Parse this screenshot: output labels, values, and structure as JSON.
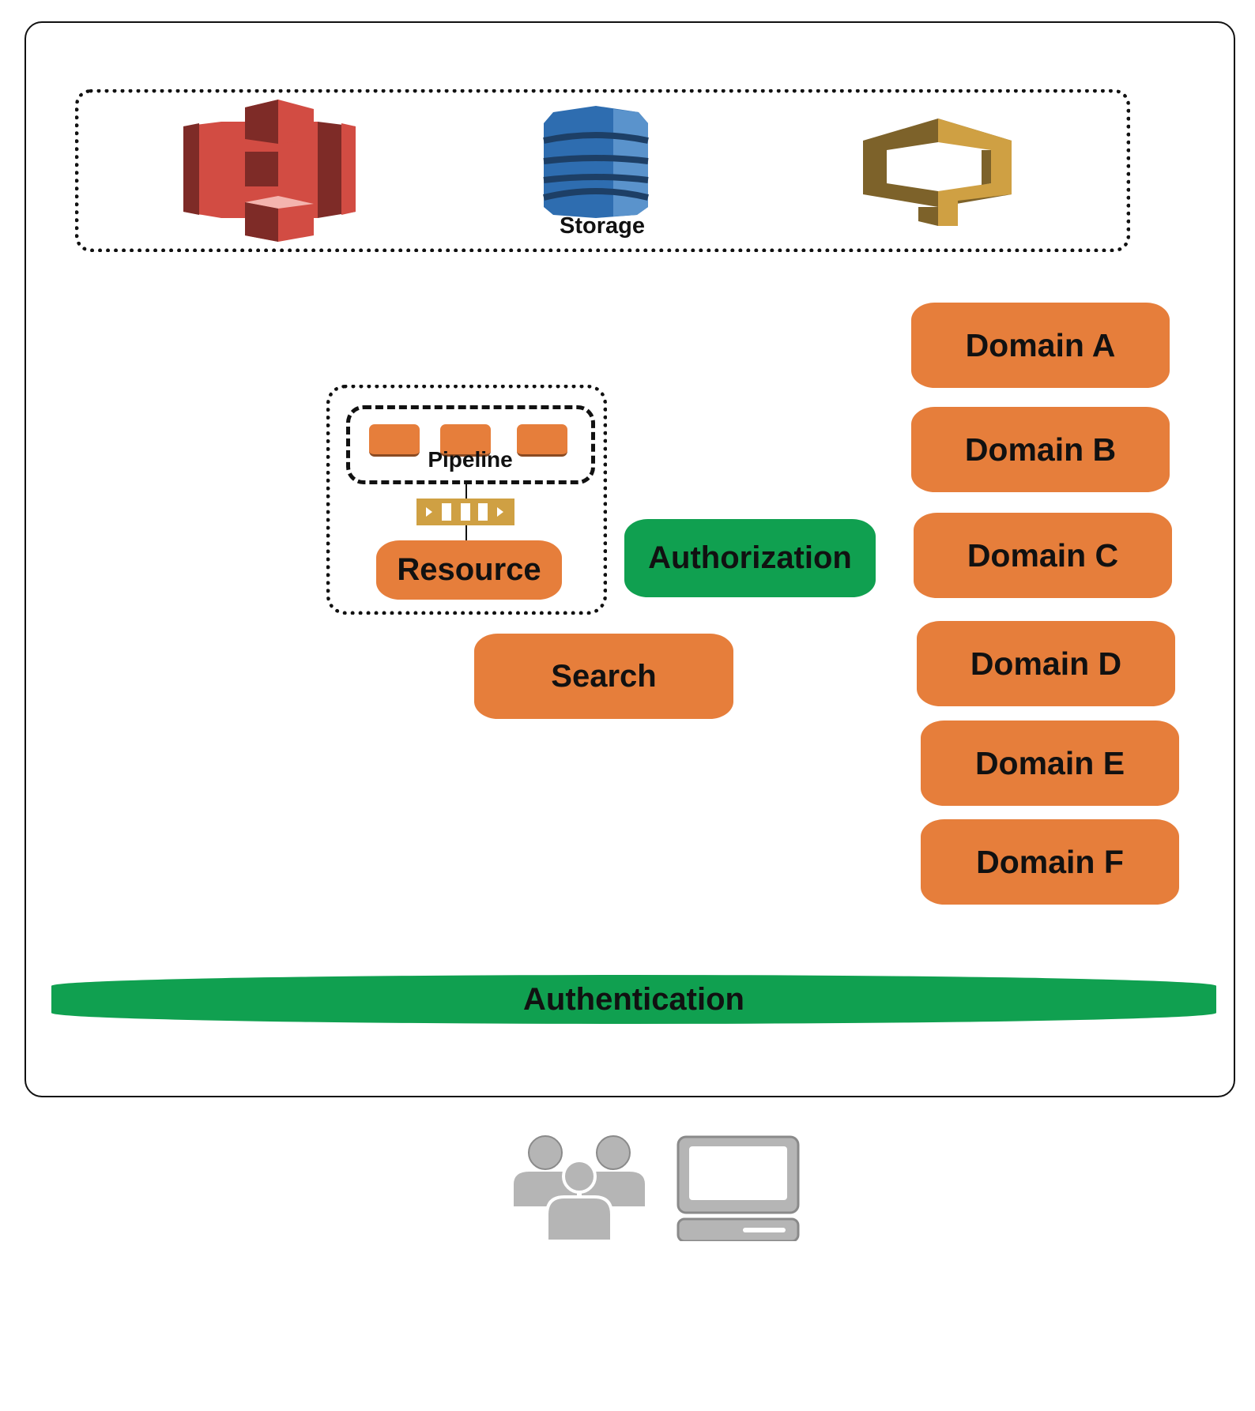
{
  "storage_group": {
    "label": "Storage",
    "icons": [
      "amazon-s3-icon",
      "amazon-dynamodb-icon",
      "amazon-workspaces-icon"
    ]
  },
  "pipeline_group": {
    "pipeline_label": "Pipeline",
    "resource_label": "Resource",
    "queue_icon": "queue-icon"
  },
  "services": {
    "authorization": "Authorization",
    "search": "Search",
    "authentication": "Authentication"
  },
  "domains": [
    "Domain A",
    "Domain B",
    "Domain C",
    "Domain D",
    "Domain E",
    "Domain F"
  ],
  "clients": [
    "users-icon",
    "computer-icon"
  ],
  "colors": {
    "orange": "#e67e3b",
    "green": "#10a050",
    "s3_red": "#d24c43",
    "dynamo_blue": "#2e6db0",
    "gold": "#cfa043",
    "client_gray": "#b5b5b5"
  }
}
